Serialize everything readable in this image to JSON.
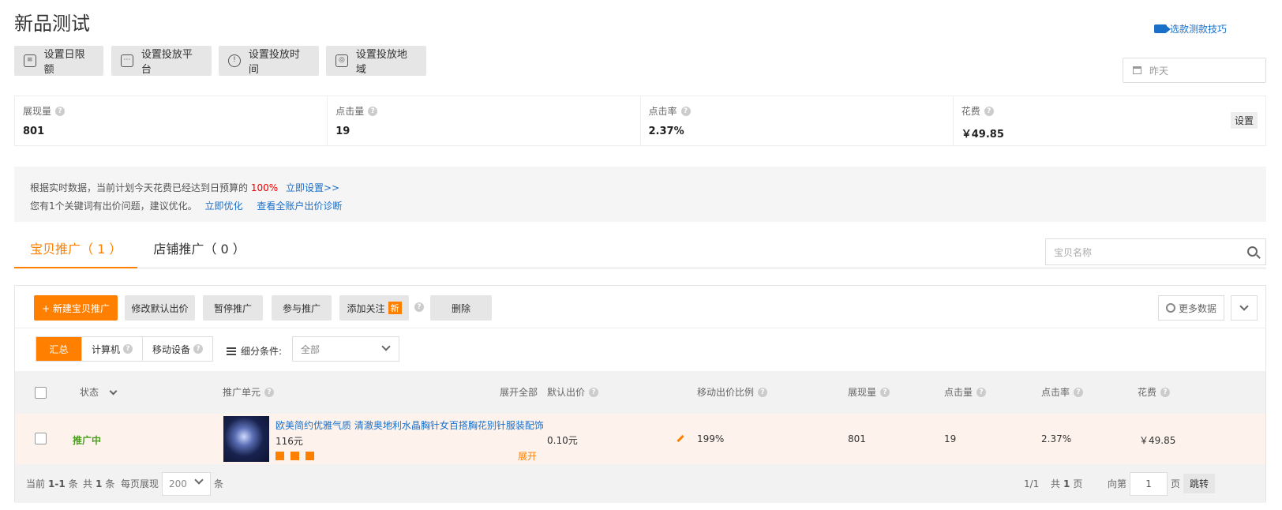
{
  "page": {
    "title": "新品测试",
    "tips_link": "选款测款技巧"
  },
  "actions": {
    "daily_limit": "设置日限额",
    "platform": "设置投放平台",
    "time": "设置投放时间",
    "region": "设置投放地域"
  },
  "date_filter": {
    "value": "昨天"
  },
  "stats": [
    {
      "label": "展现量",
      "value": "801"
    },
    {
      "label": "点击量",
      "value": "19"
    },
    {
      "label": "点击率",
      "value": "2.37%"
    },
    {
      "label": "花费",
      "value": "￥49.85"
    }
  ],
  "stats_setting_label": "设置",
  "notice": {
    "line1_text": "根据实时数据，当前计划今天花费已经达到日预算的",
    "line1_percent": "100%",
    "line1_link": "立即设置>>",
    "line2_text": "您有1个关键词有出价问题，建议优化。",
    "line2_link1": "立即优化",
    "line2_link2": "查看全账户出价诊断"
  },
  "tabs": [
    {
      "label": "宝贝推广（ 1 ）",
      "active": true
    },
    {
      "label": "店铺推广（ 0 ）",
      "active": false
    }
  ],
  "search": {
    "placeholder": "宝贝名称"
  },
  "toolbar": {
    "new": "+ 新建宝贝推广",
    "modify_bid": "修改默认出价",
    "pause": "暂停推广",
    "join": "参与推广",
    "follow": "添加关注",
    "new_tag": "新",
    "delete": "删除",
    "more_data": "更多数据"
  },
  "filter": {
    "segments": [
      "汇总",
      "计算机",
      "移动设备"
    ],
    "label": "细分条件:",
    "select_value": "全部"
  },
  "table": {
    "headers": {
      "status": "状态",
      "unit": "推广单元",
      "expand_all": "展开全部",
      "default_bid": "默认出价",
      "mobile_ratio": "移动出价比例",
      "impressions": "展现量",
      "clicks": "点击量",
      "ctr": "点击率",
      "cost": "花费"
    },
    "rows": [
      {
        "status": "推广中",
        "title": "欧美简约优雅气质 清澈奥地利水晶胸针女百搭胸花别针服装配饰",
        "price": "116元",
        "expand": "展开",
        "default_bid": "0.10元",
        "mobile_ratio": "199%",
        "impressions": "801",
        "clicks": "19",
        "ctr": "2.37%",
        "cost": "￥49.85"
      }
    ]
  },
  "pagination": {
    "current_label": "当前",
    "current_range": "1-1",
    "count_unit": "条",
    "total_label": "共",
    "total": "1",
    "per_page_label": "每页展现",
    "per_page": "200",
    "pages": "1/1",
    "total_pages_label": "共",
    "total_pages": "1",
    "page_unit": "页",
    "goto_label": "向第",
    "goto_value": "1",
    "goto_unit": "页",
    "jump": "跳转"
  }
}
